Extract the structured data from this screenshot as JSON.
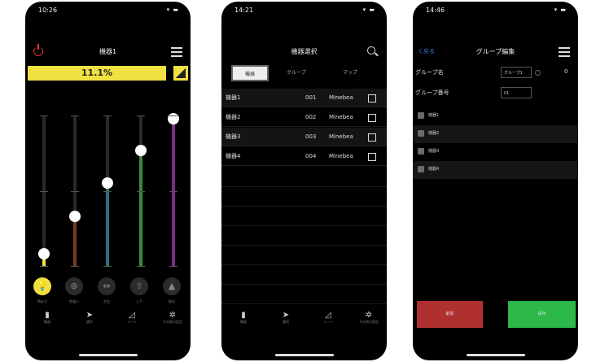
{
  "screen1": {
    "time": "10:26",
    "status_icons": "▾ ▬",
    "title": "機器1",
    "brightness": "11.1%",
    "sliders": [
      {
        "level": 0.08,
        "color": "#f0e040"
      },
      {
        "level": 0.33,
        "color": "#7a3a22"
      },
      {
        "level": 0.55,
        "color": "#2f6e80"
      },
      {
        "level": 0.77,
        "color": "#3a8a3a"
      },
      {
        "level": 0.98,
        "color": "#7a2d8a"
      }
    ],
    "modes": [
      {
        "icon": "bulb-icon",
        "glyph": "💡",
        "label": "明るさ"
      },
      {
        "icon": "color-mix-icon",
        "glyph": "⊛",
        "label": "色温い"
      },
      {
        "icon": "swap-icon",
        "glyph": "⇔",
        "label": "左右"
      },
      {
        "icon": "up-icon",
        "glyph": "⇧",
        "label": "上下"
      },
      {
        "icon": "spread-icon",
        "glyph": "▲",
        "label": "配光"
      }
    ],
    "tabs": [
      {
        "icon": "device-icon",
        "glyph": "▮",
        "label": "機器"
      },
      {
        "icon": "select-icon",
        "glyph": "➤",
        "label": "選択"
      },
      {
        "icon": "scene-icon",
        "glyph": "◿",
        "label": "シーン"
      },
      {
        "icon": "settings-icon",
        "glyph": "✲",
        "label": "その他の設定"
      }
    ]
  },
  "screen2": {
    "time": "14:21",
    "status_icons": "▾ ▬",
    "title": "機器選択",
    "segments": [
      "機器",
      "グループ",
      "マップ"
    ],
    "devices": [
      {
        "name": "機器1",
        "number": "001",
        "maker": "Minebea"
      },
      {
        "name": "機器2",
        "number": "002",
        "maker": "Minebea"
      },
      {
        "name": "機器3",
        "number": "003",
        "maker": "Minebea"
      },
      {
        "name": "機器4",
        "number": "004",
        "maker": "Minebea"
      }
    ],
    "tabs": [
      {
        "icon": "device-icon",
        "glyph": "▮",
        "label": "機器"
      },
      {
        "icon": "select-icon",
        "glyph": "➤",
        "label": "選択"
      },
      {
        "icon": "scene-icon",
        "glyph": "◿",
        "label": "シーン"
      },
      {
        "icon": "settings-icon",
        "glyph": "✲",
        "label": "その他の設定"
      }
    ]
  },
  "screen3": {
    "time": "14:46",
    "status_icons": "▾ ▬",
    "back_label": "く戻る",
    "title": "グループ編集",
    "group_name_label": "グループ名",
    "group_name_value": "グループ1",
    "group_name_count": "0",
    "group_number_label": "グループ番号",
    "group_number_value": "01",
    "members": [
      "機器1",
      "機器2",
      "機器3",
      "機器4"
    ],
    "delete_label": "削除",
    "save_label": "保存"
  }
}
